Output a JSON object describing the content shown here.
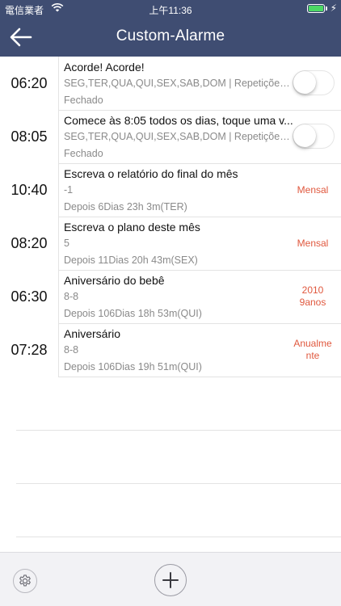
{
  "status_bar": {
    "carrier": "電信業者",
    "time": "上午11:36"
  },
  "nav": {
    "title": "Custom-Alarme",
    "back_icon": "arrow-left-icon"
  },
  "alarms": [
    {
      "time": "06:20",
      "title": "Acorde! Acorde!",
      "repeat": "SEG,TER,QUA,QUI,SEX,SAB,DOM | Repetições:...",
      "status": "Fechado",
      "enabled": false
    },
    {
      "time": "08:05",
      "title": "Comece às 8:05 todos os dias, toque uma v...",
      "repeat": "SEG,TER,QUA,QUI,SEX,SAB,DOM | Repetições:...",
      "status": "Fechado",
      "enabled": false
    }
  ],
  "reminders": [
    {
      "time": "10:40",
      "title": "Escreva o relatório do final do mês",
      "detail": "-1",
      "countdown": "Depois 6Dias 23h 3m(TER)",
      "tag": "Mensal"
    },
    {
      "time": "08:20",
      "title": "Escreva o plano deste mês",
      "detail": "5",
      "countdown": "Depois 11Dias 20h 43m(SEX)",
      "tag": "Mensal"
    },
    {
      "time": "06:30",
      "title": "Aniversário do bebê",
      "detail": "8-8",
      "countdown": "Depois 106Dias 18h 53m(QUI)",
      "tag": "2010\n9anos"
    },
    {
      "time": "07:28",
      "title": "Aniversário",
      "detail": "8-8",
      "countdown": "Depois 106Dias 19h 51m(QUI)",
      "tag": "Anualme\nnte"
    }
  ],
  "bottom_bar": {
    "settings_icon": "gear-icon",
    "add_icon": "plus-icon"
  },
  "colors": {
    "header": "#3f4d72",
    "tag": "#e0583e",
    "secondary_text": "#8a8a8a",
    "bottom_bar": "#f2f2f5"
  }
}
